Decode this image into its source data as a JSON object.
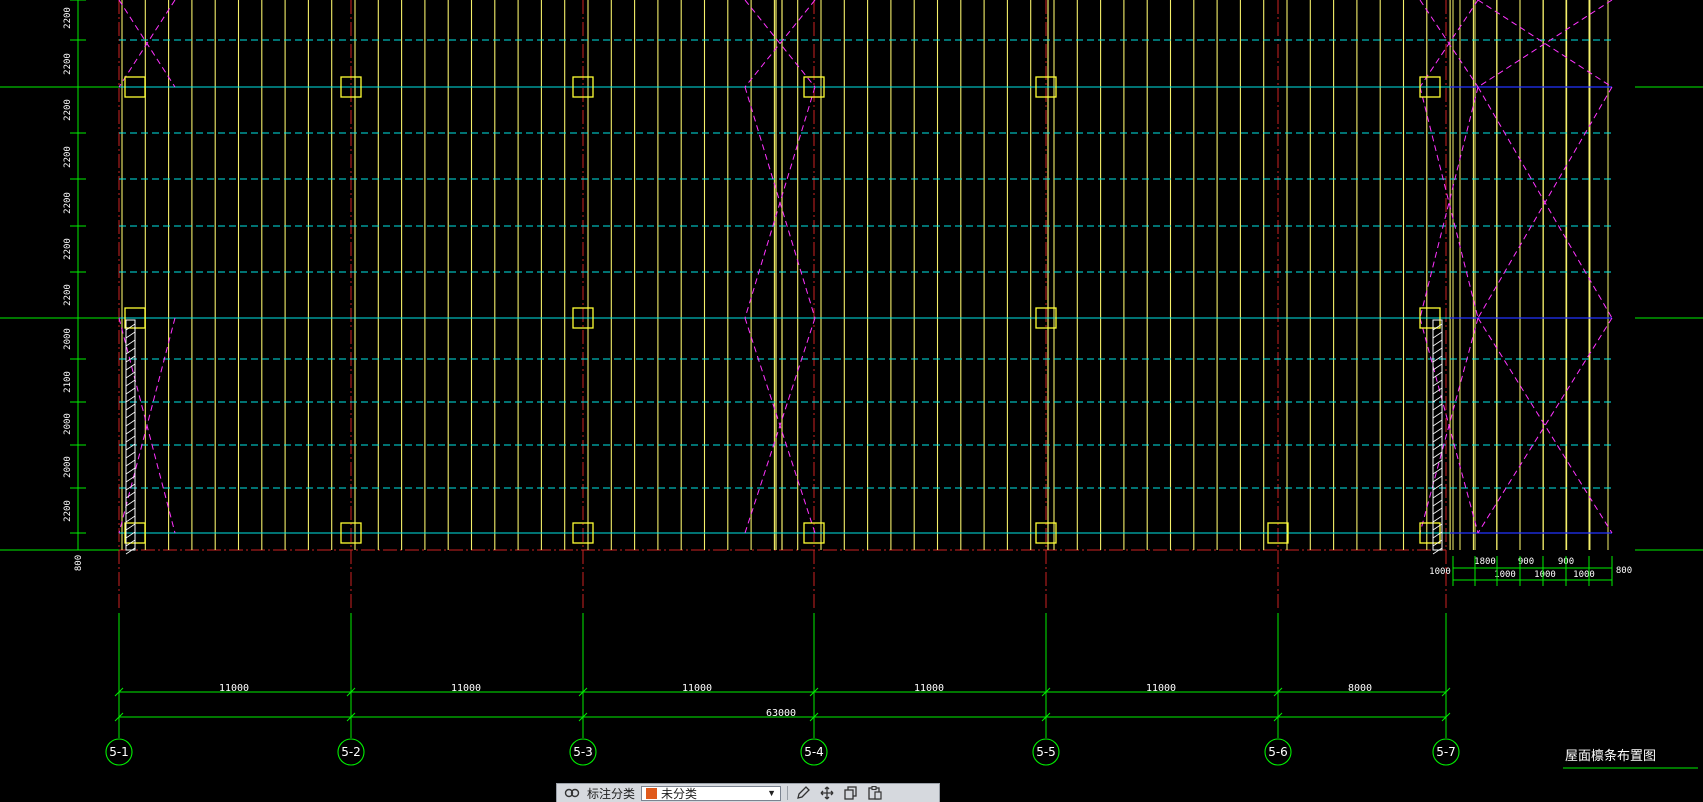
{
  "drawing": {
    "title": "屋面檩条布置图",
    "axis_labels": [
      "5-1",
      "5-2",
      "5-3",
      "5-4",
      "5-5",
      "5-6",
      "5-7"
    ],
    "bay_dims": [
      "11000",
      "11000",
      "11000",
      "11000",
      "11000",
      "8000"
    ],
    "total_dim": "63000",
    "left_dims": [
      "2200",
      "2200",
      "2200",
      "2200",
      "2200",
      "2200",
      "2200",
      "2000",
      "2100",
      "2000",
      "2000",
      "2200"
    ],
    "bottom_left_dim": "800",
    "right_dims_top": [
      "1800",
      "900",
      "900"
    ],
    "right_dims_bottom": [
      "1000",
      "1000",
      "1000",
      "900"
    ],
    "right_edge_dim_left": "1000",
    "right_edge_dim_right": "800",
    "colors": {
      "background": "#000000",
      "purlin": "#f5f06a",
      "axis_line": "#00ee00",
      "dashed_bracing": "#00e5e5",
      "cross_bracing": "#ff33ff",
      "column": "#ffff33",
      "grid_dashdot": "#cc2222",
      "tie_line": "#2233ff"
    }
  },
  "toolbar": {
    "label": "标注分类",
    "selected": "未分类",
    "swatch_color": "#e05a1c",
    "icons": [
      "link-icon",
      "edit-icon",
      "move-icon",
      "copy-icon",
      "paste-icon"
    ]
  }
}
